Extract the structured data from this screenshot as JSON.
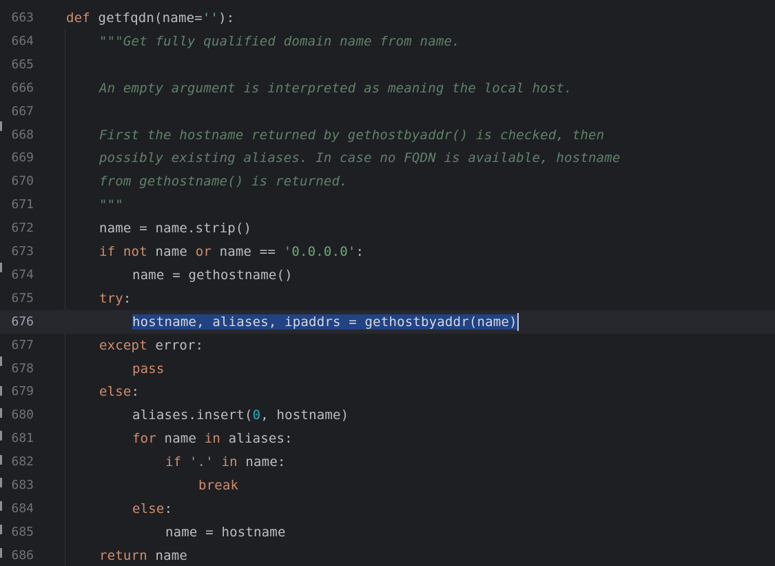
{
  "editor": {
    "lines": [
      {
        "num": "663",
        "indent": 0,
        "tokens": [
          {
            "t": "def",
            "c": "kw"
          },
          {
            "t": " getfqdn(name="
          },
          {
            "t": "''",
            "c": "str"
          },
          {
            "t": "):"
          }
        ]
      },
      {
        "num": "664",
        "indent": 4,
        "tokens": [
          {
            "t": "\"\"\"Get fully qualified domain name from name.",
            "c": "doc"
          }
        ]
      },
      {
        "num": "665",
        "indent": 0,
        "tokens": []
      },
      {
        "num": "666",
        "indent": 4,
        "tokens": [
          {
            "t": "An empty argument is interpreted as meaning the local host.",
            "c": "doc"
          }
        ]
      },
      {
        "num": "667",
        "indent": 0,
        "tokens": []
      },
      {
        "num": "668",
        "indent": 4,
        "tokens": [
          {
            "t": "First the hostname returned by gethostbyaddr() is checked, then",
            "c": "doc"
          }
        ]
      },
      {
        "num": "669",
        "indent": 4,
        "tokens": [
          {
            "t": "possibly existing aliases. In case no FQDN is available, hostname",
            "c": "doc"
          }
        ]
      },
      {
        "num": "670",
        "indent": 4,
        "tokens": [
          {
            "t": "from gethostname() is returned.",
            "c": "doc"
          }
        ]
      },
      {
        "num": "671",
        "indent": 4,
        "tokens": [
          {
            "t": "\"\"\"",
            "c": "doc"
          }
        ]
      },
      {
        "num": "672",
        "indent": 4,
        "tokens": [
          {
            "t": "name = name.strip()"
          }
        ]
      },
      {
        "num": "673",
        "indent": 4,
        "tokens": [
          {
            "t": "if",
            "c": "kw"
          },
          {
            "t": " "
          },
          {
            "t": "not",
            "c": "kw"
          },
          {
            "t": " name "
          },
          {
            "t": "or",
            "c": "kw"
          },
          {
            "t": " name == "
          },
          {
            "t": "'0.0.0.0'",
            "c": "str"
          },
          {
            "t": ":"
          }
        ]
      },
      {
        "num": "674",
        "indent": 8,
        "tokens": [
          {
            "t": "name = gethostname()"
          }
        ]
      },
      {
        "num": "675",
        "indent": 4,
        "tokens": [
          {
            "t": "try",
            "c": "kw"
          },
          {
            "t": ":"
          }
        ]
      },
      {
        "num": "676",
        "indent": 8,
        "current": true,
        "tokens": [
          {
            "t": "hostname, aliases, ipaddrs = gethostbyaddr(name)",
            "c": "sel"
          }
        ],
        "caret": true
      },
      {
        "num": "677",
        "indent": 4,
        "tokens": [
          {
            "t": "except",
            "c": "kw"
          },
          {
            "t": " error:"
          }
        ]
      },
      {
        "num": "678",
        "indent": 8,
        "tokens": [
          {
            "t": "pass",
            "c": "kw"
          }
        ]
      },
      {
        "num": "679",
        "indent": 4,
        "tokens": [
          {
            "t": "else",
            "c": "kw"
          },
          {
            "t": ":"
          }
        ]
      },
      {
        "num": "680",
        "indent": 8,
        "tokens": [
          {
            "t": "aliases.insert("
          },
          {
            "t": "0",
            "c": "num"
          },
          {
            "t": ", hostname)"
          }
        ]
      },
      {
        "num": "681",
        "indent": 8,
        "tokens": [
          {
            "t": "for",
            "c": "kw"
          },
          {
            "t": " name "
          },
          {
            "t": "in",
            "c": "kw"
          },
          {
            "t": " aliases:"
          }
        ]
      },
      {
        "num": "682",
        "indent": 12,
        "tokens": [
          {
            "t": "if",
            "c": "kw"
          },
          {
            "t": " "
          },
          {
            "t": "'.'",
            "c": "str"
          },
          {
            "t": " "
          },
          {
            "t": "in",
            "c": "kw"
          },
          {
            "t": " name:"
          }
        ]
      },
      {
        "num": "683",
        "indent": 16,
        "tokens": [
          {
            "t": "break",
            "c": "kw"
          }
        ]
      },
      {
        "num": "684",
        "indent": 8,
        "tokens": [
          {
            "t": "else",
            "c": "kw"
          },
          {
            "t": ":"
          }
        ]
      },
      {
        "num": "685",
        "indent": 12,
        "tokens": [
          {
            "t": "name = hostname"
          }
        ]
      },
      {
        "num": "686",
        "indent": 4,
        "tokens": [
          {
            "t": "return",
            "c": "kw"
          },
          {
            "t": " name"
          }
        ]
      }
    ]
  },
  "colors": {
    "background": "#1e1f22",
    "keyword": "#cf8e6d",
    "string": "#6aab73",
    "docstring": "#5f826b",
    "number": "#2aacb8",
    "selection": "#214283",
    "line_number": "#6f737a"
  }
}
